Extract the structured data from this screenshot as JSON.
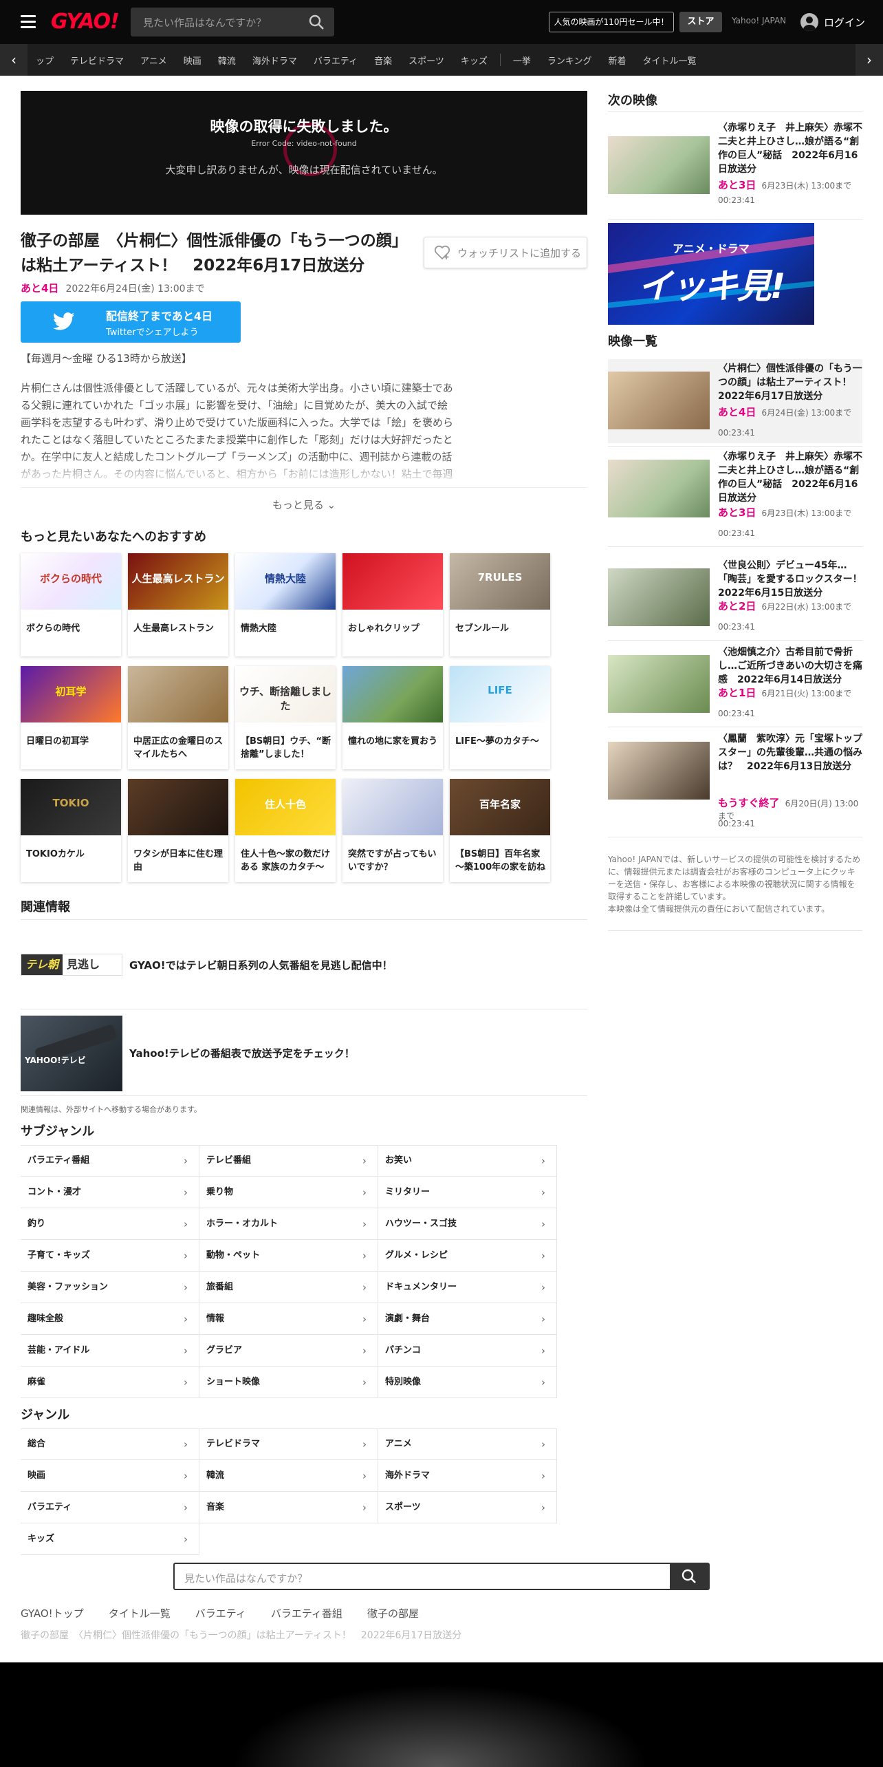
{
  "header": {
    "logo": "GYAO!",
    "search_placeholder": "見たい作品はなんですか？",
    "sale_banner": "人気の映画が110円セール中！",
    "store": "ストア",
    "yahoo_japan": "Yahoo! JAPAN",
    "login": "ログイン"
  },
  "nav": {
    "items": [
      "ップ",
      "テレビドラマ",
      "アニメ",
      "映画",
      "韓流",
      "海外ドラマ",
      "バラエティ",
      "音楽",
      "スポーツ",
      "キッズ"
    ],
    "items2": [
      "一挙",
      "ランキング",
      "新着",
      "タイトル一覧"
    ]
  },
  "player": {
    "error_title": "映像の取得に失敗しました。",
    "error_code": "Error Code: video-not-found",
    "error_message": "大変申し訳ありませんが、映像は現在配信されていません。"
  },
  "video": {
    "title": "徹子の部屋　〈片桐仁〉個性派俳優の「もう一つの顔」は粘土アーティスト！　2022年6月17日放送分",
    "watchlist": "ウォッチリストに追加する",
    "remaining": "あと4日",
    "until": "2022年6月24日(金) 13:00まで",
    "twitter_line1": "配信終了まであと4日",
    "twitter_line2": "Twitterでシェアしよう",
    "schedule": "【毎週月～金曜 ひる13時から放送】",
    "description": "片桐仁さんは個性派俳優として活躍しているが、元々は美術大学出身。小さい頃に建築士である父親に連れていかれた「ゴッホ展」に影響を受け、「油絵」に目覚めたが、美大の入試で絵画学科を志望するも叶わず、滑り止めで受けていた版画科に入った。大学では「絵」を褒められたことはなく落胆していたところたまたま授業中に創作した「彫刻」だけは大好評だったとか。在学中に友人と結成したコントグループ「ラーメンズ」の活動中に、週刊誌から連載の話があった片桐さん。その内容に悩んでいると、相方から「お前には造形しかない！粘土で毎週作品を創れ」と背中を押され、結果20年以上に及ぶ「粘土アート」作りが始まったそう。そして",
    "more": "もっと見る"
  },
  "recommend": {
    "heading": "もっと見たいあなたへのおすすめ",
    "items": [
      {
        "title": "ボクらの時代"
      },
      {
        "title": "人生最高レストラン"
      },
      {
        "title": "情熱大陸"
      },
      {
        "title": "おしゃれクリップ"
      },
      {
        "title": "セブンルール"
      },
      {
        "title": "日曜日の初耳学"
      },
      {
        "title": "中居正広の金曜日のスマイルたちへ"
      },
      {
        "title": "【BS朝日】ウチ、“断捨離”しました！"
      },
      {
        "title": "憧れの地に家を買おう"
      },
      {
        "title": "LIFE～夢のカタチ～"
      },
      {
        "title": "TOKIOカケル"
      },
      {
        "title": "ワタシが日本に住む理由"
      },
      {
        "title": "住人十色～家の数だけある 家族のカタチ～"
      },
      {
        "title": "突然ですが占ってもいいですか？"
      },
      {
        "title": "【BS朝日】百年名家～築100年の家を訪ね"
      }
    ],
    "thumb_texts": [
      "ボクらの時代",
      "人生最高レストラン",
      "情熱大陸",
      "",
      "7RULES",
      "初耳学",
      "",
      "ウチ、断捨離しました",
      "",
      "LIFE",
      "TOKIO",
      "",
      "住人十色",
      "",
      "百年名家"
    ]
  },
  "related": {
    "heading": "関連情報",
    "item1": "GYAO!ではテレビ朝日系列の人気番組を見逃し配信中！",
    "item1_logo_a": "テレ朝",
    "item1_logo_b": "見逃し",
    "item2": "Yahoo!テレビの番組表で放送予定をチェック！",
    "item2_logo": "YAHOO!テレビ",
    "note": "関連情報は、外部サイトへ移動する場合があります。"
  },
  "subgenre": {
    "heading": "サブジャンル",
    "items": [
      "バラエティ番組",
      "テレビ番組",
      "お笑い",
      "コント・漫才",
      "乗り物",
      "ミリタリー",
      "釣り",
      "ホラー・オカルト",
      "ハウツー・スゴ技",
      "子育て・キッズ",
      "動物・ペット",
      "グルメ・レシピ",
      "美容・ファッション",
      "旅番組",
      "ドキュメンタリー",
      "趣味全般",
      "情報",
      "演劇・舞台",
      "芸能・アイドル",
      "グラビア",
      "パチンコ",
      "麻雀",
      "ショート映像",
      "特別映像"
    ]
  },
  "genre": {
    "heading": "ジャンル",
    "items": [
      "総合",
      "テレビドラマ",
      "アニメ",
      "映画",
      "韓流",
      "海外ドラマ",
      "バラエティ",
      "音楽",
      "スポーツ",
      "キッズ"
    ]
  },
  "footer": {
    "search_placeholder": "見たい作品はなんですか？",
    "breadcrumb": [
      "GYAO!トップ",
      "タイトル一覧",
      "バラエティ",
      "バラエティ番組",
      "徹子の部屋"
    ],
    "current": "徹子の部屋　〈片桐仁〉個性派俳優の「もう一つの顔」は粘土アーティスト！　2022年6月17日放送分"
  },
  "sidebar": {
    "next_heading": "次の映像",
    "next": {
      "title": "〈赤塚りえ子　井上麻矢〉赤塚不二夫と井上ひさし…娘が語る“創作の巨人”秘話　2022年6月16日放送分",
      "remaining": "あと3日",
      "until": "6月23日(木) 13:00まで",
      "duration": "00:23:41"
    },
    "banner_line1": "アニメ・ドラマ",
    "banner_line2": "イッキ見!",
    "list_heading": "映像一覧",
    "list": [
      {
        "title": "〈片桐仁〉個性派俳優の「もう一つの顔」は粘土アーティスト！　2022年6月17日放送分",
        "remaining": "あと4日",
        "until": "6月24日(金) 13:00まで",
        "duration": "00:23:41"
      },
      {
        "title": "〈赤塚りえ子　井上麻矢〉赤塚不二夫と井上ひさし…娘が語る“創作の巨人”秘話　2022年6月16日放送分",
        "remaining": "あと3日",
        "until": "6月23日(木) 13:00まで",
        "duration": "00:23:41"
      },
      {
        "title": "〈世良公則〉デビュー45年…「陶芸」を愛するロックスター！　2022年6月15日放送分",
        "remaining": "あと2日",
        "until": "6月22日(水) 13:00まで",
        "duration": "00:23:41"
      },
      {
        "title": "〈池畑慎之介〉古希目前で骨折し…ご近所づきあいの大切さを痛感　2022年6月14日放送分",
        "remaining": "あと1日",
        "until": "6月21日(火) 13:00まで",
        "duration": "00:23:41"
      },
      {
        "title": "〈鳳蘭　紫吹淳〉元「宝塚トップスター」の先輩後輩…共通の悩みは？　2022年6月13日放送分",
        "remaining": "もうすぐ終了",
        "until": "6月20日(月) 13:00まで",
        "duration": "00:23:41"
      }
    ],
    "footnote": "Yahoo! JAPANでは、新しいサービスの提供の可能性を検討するために、情報提供元または調査会社がお客様のコンピュータ上にクッキーを送信・保存し、お客様による本映像の視聴状況に関する情報を取得することを許諾しています。",
    "footnote2": "本映像は全て情報提供元の責任において配信されています。"
  }
}
